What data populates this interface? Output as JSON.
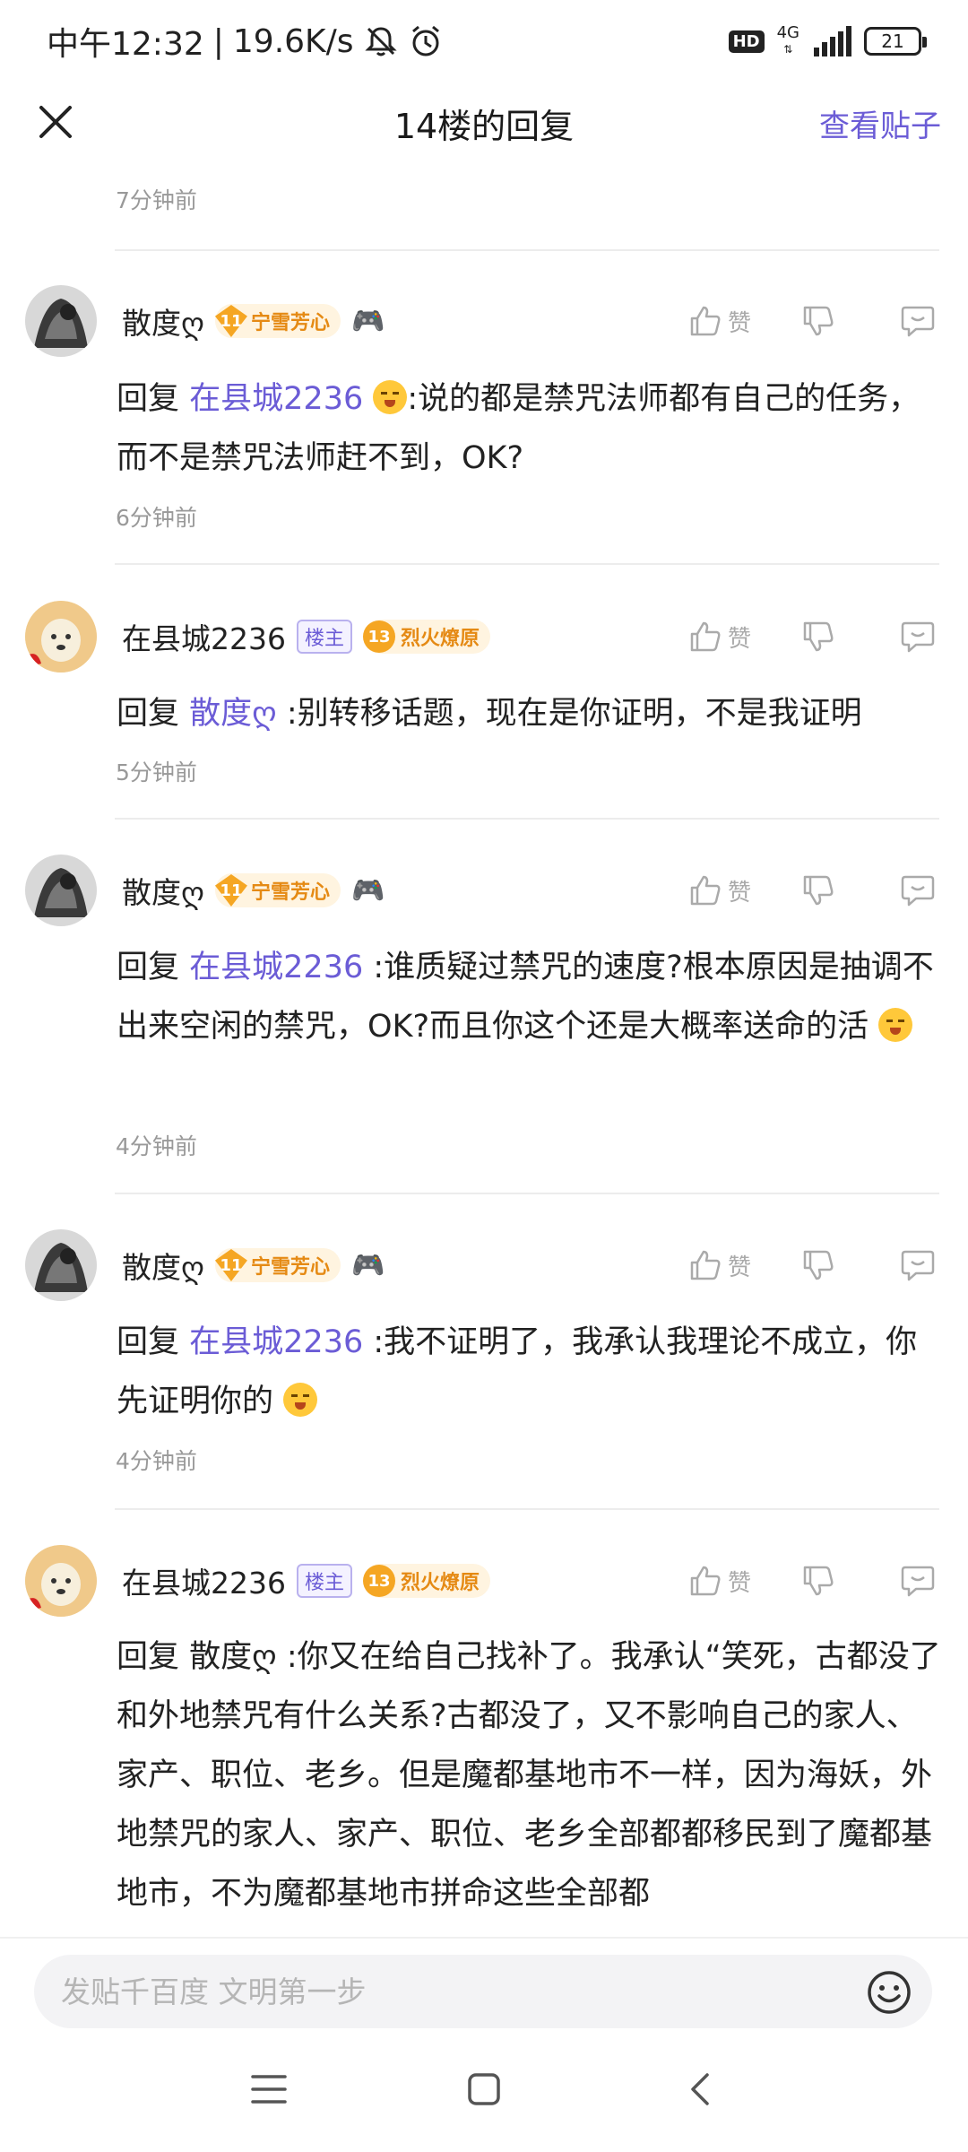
{
  "status_bar": {
    "time": "中午12:32",
    "speed": "19.6K/s",
    "hd": "HD",
    "network": "4G",
    "battery": "21"
  },
  "header": {
    "title": "14楼的回复",
    "view_post": "查看贴子"
  },
  "top_time": "7分钟前",
  "like_label": "赞",
  "reply_prefix": "回复",
  "comments": [
    {
      "user": "散度ღ",
      "level": "11",
      "level_title": "宁雪芳心",
      "reply_to": "在县城2236",
      "text": ":说的都是禁咒法师都有自己的任务，而不是禁咒法师赶不到，OK?",
      "time": "6分钟前"
    },
    {
      "user": "在县城2236",
      "owner_badge": "楼主",
      "level": "13",
      "level_title": "烈火燎原",
      "reply_to": "散度ღ",
      "text": ":别转移话题，现在是你证明，不是我证明",
      "time": "5分钟前"
    },
    {
      "user": "散度ღ",
      "level": "11",
      "level_title": "宁雪芳心",
      "reply_to": "在县城2236",
      "text": ":谁质疑过禁咒的速度?根本原因是抽调不出来空闲的禁咒，OK?而且你这个还是大概率送命的活",
      "time": "4分钟前"
    },
    {
      "user": "散度ღ",
      "level": "11",
      "level_title": "宁雪芳心",
      "reply_to": "在县城2236",
      "text": ":我不证明了，我承认我理论不成立，你先证明你的",
      "time": "4分钟前"
    },
    {
      "user": "在县城2236",
      "owner_badge": "楼主",
      "level": "13",
      "level_title": "烈火燎原",
      "reply_to": "散度ღ",
      "text": ":你又在给自己找补了。我承认“笑死，古都没了和外地禁咒有什么关系?古都没了，又不影响自己的家人、家产、职位、老乡。但是魔都基地市不一样，因为海妖，外地禁咒的家人、家产、职位、老乡全部都都移民到了魔都基地市，不为魔都基地市拼命这些全部都"
    }
  ],
  "input": {
    "placeholder": "发贴千百度 文明第一步"
  }
}
